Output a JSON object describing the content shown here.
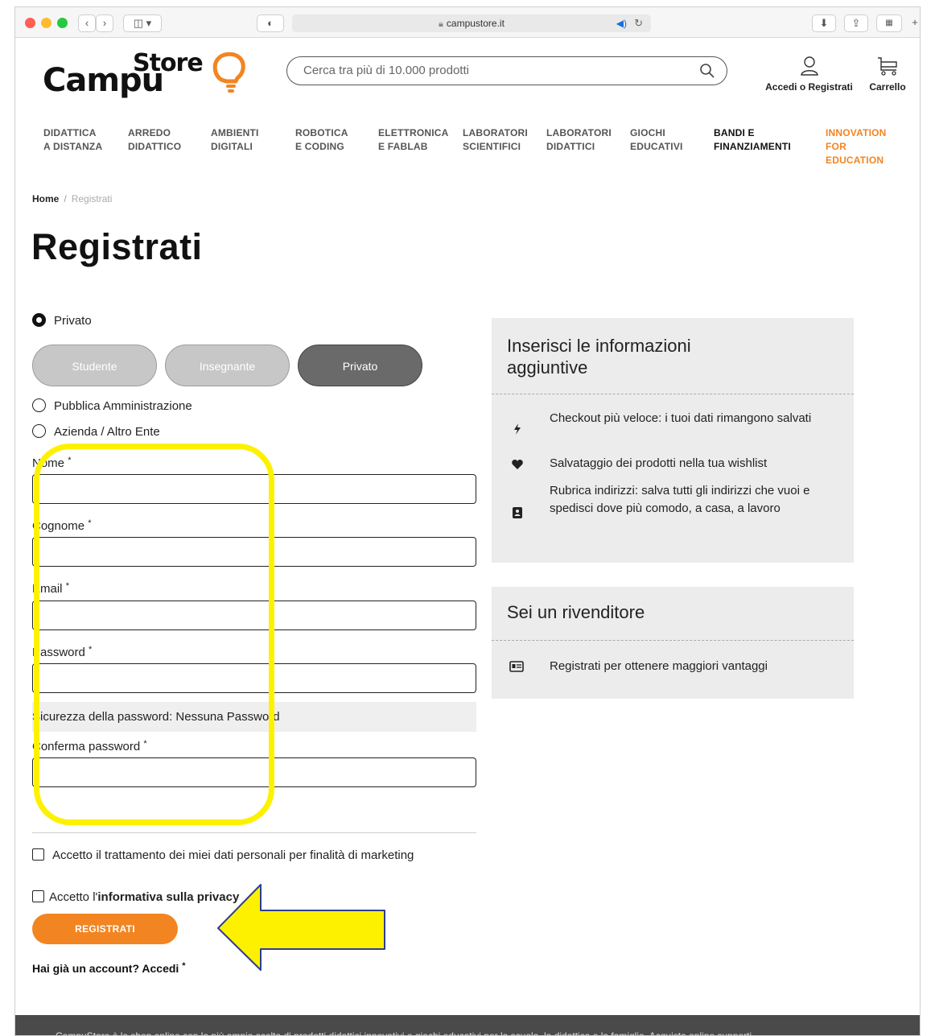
{
  "browser": {
    "url": "campustore.it",
    "traffic_lights": [
      "#ff5f57",
      "#febc2e",
      "#28c840"
    ]
  },
  "header": {
    "logo_part1": "Campu",
    "logo_part2": "Store",
    "search_placeholder": "Cerca tra più di 10.000 prodotti",
    "account_label": "Accedi o Registrati",
    "cart_label": "Carrello"
  },
  "nav": [
    {
      "label": "DIDATTICA\nA DISTANZA"
    },
    {
      "label": "ARREDO\nDIDATTICO"
    },
    {
      "label": "AMBIENTI\nDIGITALI"
    },
    {
      "label": "ROBOTICA\nE CODING"
    },
    {
      "label": "ELETTRONICA\nE FABLAB"
    },
    {
      "label": "LABORATORI\nSCIENTIFICI"
    },
    {
      "label": "LABORATORI\nDIDATTICI"
    },
    {
      "label": "GIOCHI\nEDUCATIVI"
    },
    {
      "label": "BANDI E\nFINANZIAMENTI"
    },
    {
      "label": "INNOVATION\nFOR\nEDUCATION"
    }
  ],
  "breadcrumb": {
    "home": "Home",
    "separator": "/",
    "current": "Registrati"
  },
  "page_title": "Registrati",
  "form": {
    "customer_types": [
      {
        "label": "Privato",
        "selected": true
      },
      {
        "label": "Pubblica Amministrazione",
        "selected": false
      },
      {
        "label": "Azienda / Altro Ente",
        "selected": false
      }
    ],
    "subtype_buttons": [
      {
        "label": "Studente",
        "active": false
      },
      {
        "label": "Insegnante",
        "active": false
      },
      {
        "label": "Privato",
        "active": true
      }
    ],
    "fields": [
      {
        "label": "Nome",
        "value": ""
      },
      {
        "label": "Cognome",
        "value": ""
      },
      {
        "label": "Email",
        "value": ""
      },
      {
        "label": "Password",
        "value": ""
      },
      {
        "label": "Conferma password",
        "value": ""
      }
    ],
    "required_mark": "*",
    "password_strength": "Sicurezza della password: Nessuna Password",
    "marketing_consent": "Accetto il trattamento dei miei dati personali per finalità di marketing",
    "privacy_prefix": "Accetto l'",
    "privacy_link": "informativa sulla privacy",
    "submit_label": "REGISTRATI",
    "login_prompt": "Hai già un account? Accedi"
  },
  "info_box": {
    "title": "Inserisci le informazioni aggiuntive",
    "benefits": [
      {
        "icon": "bolt-icon",
        "text": "Checkout più veloce: i tuoi dati rimangono salvati"
      },
      {
        "icon": "heart-icon",
        "text": "Salvataggio dei prodotti nella tua wishlist"
      },
      {
        "icon": "address-book-icon",
        "text": "Rubrica indirizzi: salva tutti gli indirizzi che vuoi e spedisci dove più comodo, a casa, a lavoro"
      }
    ]
  },
  "reseller_box": {
    "title": "Sei un rivenditore",
    "text": "Registrati per ottenere maggiori vantaggi"
  },
  "footer": {
    "text": "CampuStore è lo shop online con la più ampia scelta di prodotti didattici innovativi e giochi educativi per la scuola, la didattica e la famiglia. Acquista online supporti"
  },
  "colors": {
    "accent": "#f28521",
    "highlight": "#fdf100",
    "footer_bg": "#4a4a4a"
  }
}
